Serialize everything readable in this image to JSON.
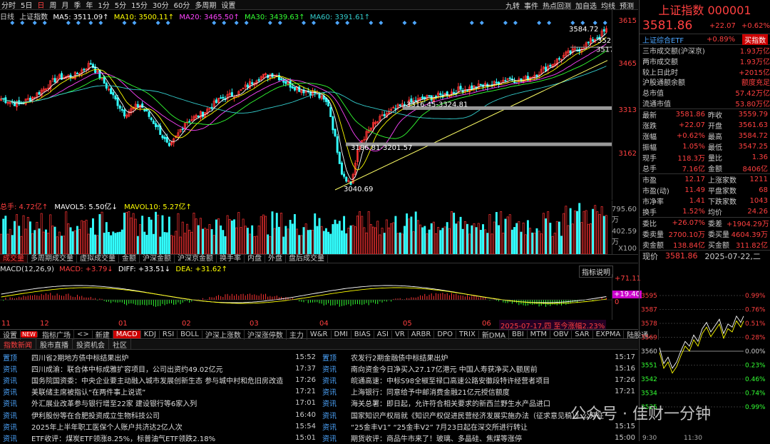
{
  "toolbar": {
    "items": [
      "分时",
      "5日",
      "日",
      "周",
      "月",
      "季",
      "年",
      "1分",
      "5分",
      "15分",
      "30分",
      "60分",
      "多周期",
      "设置"
    ],
    "selected": "日",
    "right": [
      "九转",
      "事件",
      "热点回测",
      "加自选",
      "均线",
      "预测"
    ]
  },
  "ma": {
    "period": "日线",
    "name": "上证指数",
    "ma5": "MA5: 3511.09↑",
    "ma10": "MA10: 3500.11↑",
    "ma20": "MA20: 3465.50↑",
    "ma30": "MA30: 3439.63↑",
    "ma60": "MA60: 3391.61↑"
  },
  "price_axis": {
    "labels": [
      "3615",
      "3465",
      "3313",
      "3162"
    ]
  },
  "annotations": {
    "high": "3584.72",
    "p1": "3316.45-3324.81",
    "p2": "3186.81-3201.57",
    "low": "3040.69",
    "r1": "352",
    "r2": "3517"
  },
  "volume": {
    "head_total": "总手: 4.72亿↑",
    "mavol5": "MAVOL5: 5.50亿↓",
    "mavol10": "MAVOL10: 5.27亿↑",
    "axis": [
      "795.60万",
      "402.59万",
      "X100"
    ]
  },
  "vtabs": [
    "成交量",
    "多周期成交量",
    "虚拟成交量",
    "金额",
    "沪深金额",
    "沪深京金额",
    "换手率",
    "内盘",
    "外盘",
    "盘后成交量"
  ],
  "macd": {
    "head": "MACD(12,26,9)",
    "macd": "MACD: +3.79↓",
    "diff": "DIFF: +33.51↓",
    "dea": "DEA: +31.62↑",
    "legend": "指标说明",
    "axis_top": "+71.11",
    "axis_mid": "+19.40",
    "axis_zero": "0"
  },
  "dates": [
    "11",
    "12",
    "01",
    "02",
    "03",
    "04",
    "05",
    "06"
  ],
  "date_highlight": "2025-07-17,四 至今涨幅2.23%",
  "bottom_tabs": [
    "设置",
    "NEW",
    "指标广场",
    "<>",
    "新建",
    "MACD",
    "KDJ",
    "RSI",
    "BOLL",
    "沪深上涨数",
    "沪深涨停数",
    "主力",
    "W&R",
    "DMI",
    "BIAS",
    "ASI",
    "VR",
    "ARBR",
    "DPO",
    "TRIX",
    "新DMA",
    "BBI",
    "MTM",
    "OBV",
    "SAR",
    "EXPMA",
    "陆股通..."
  ],
  "news_tabs": [
    "指数新闻",
    "股市直播",
    "投资机会",
    "社区"
  ],
  "news_left": [
    {
      "tag": "置顶",
      "title": "四川省2期地方债中标结果出炉",
      "time": "15:52"
    },
    {
      "tag": "资讯",
      "title": "四川成渝：联合体中标成雅扩容项目，公司出资约49.02亿元",
      "time": "17:37"
    },
    {
      "tag": "资讯",
      "title": "国务院国资委：中央企业要主动融入城市发展创新生态 参与城中村和危旧房改造",
      "time": "17:26"
    },
    {
      "tag": "资讯",
      "title": "美联储主席被指认“在两件事上说谎”",
      "time": "17:21"
    },
    {
      "tag": "资讯",
      "title": "外汇展业改革参与银行增至22家 建设银行等6家入列",
      "time": "17:01"
    },
    {
      "tag": "资讯",
      "title": "伊利股份等在合肥投资成立生物科技公司",
      "time": "16:40"
    },
    {
      "tag": "资讯",
      "title": "2025年上半年职工医保个人账户共济达2亿人次",
      "time": "15:54"
    },
    {
      "tag": "资讯",
      "title": "ETF收评：煤炭ETF领涨8.25%，标普油气ETF领跌2.18%",
      "time": "15:01"
    }
  ],
  "news_right": [
    {
      "tag": "置顶",
      "title": "农发行2期金融债中标结果出炉",
      "time": "15:17"
    },
    {
      "tag": "资讯",
      "title": "南向资金今日净买入27.17亿港元 中国人寿获净买入额居前",
      "time": "15:16"
    },
    {
      "tag": "资讯",
      "title": "皖通高速：中标S98全椒至禄口高速公路安徽段特许经营者项目",
      "time": "17:26"
    },
    {
      "tag": "资讯",
      "title": "上海银行：同意给予中邮消费金融21亿元授信额度",
      "time": "17:21"
    },
    {
      "tag": "资讯",
      "title": "海关总署：即日起，允许符合相关要求的新西兰野生水产品进口",
      "time": ""
    },
    {
      "tag": "资讯",
      "title": "国家知识产权局就《知识产权促进民营经济发展实施办法（征求意见稿）》公开征",
      "time": ""
    },
    {
      "tag": "资讯",
      "title": "“25金丰V1” “25金丰V2” 7月23日起在深交所进行转让",
      "time": "15:15"
    },
    {
      "tag": "资讯",
      "title": "期货收评：商品牛市来了！玻璃、多晶硅、焦煤等涨停",
      "time": "15:00"
    }
  ],
  "quote": {
    "title": "上证指数 000001",
    "price": "3581.86",
    "chg": "+22.07",
    "pct": "+0.62%",
    "etf_name": "上证综合ETF",
    "etf_pct": "+0.89%",
    "etf_btn": "买指数",
    "kv": [
      {
        "k": "三市成交额(沪深京)",
        "v": "1.93万亿"
      },
      {
        "k": "两市成交额",
        "v": "1.93万亿"
      },
      {
        "k": "较上日此时",
        "v": "+2015亿"
      },
      {
        "k": "沪股通额余额",
        "v": "额度充足"
      },
      {
        "k": "总市值",
        "v": "57.42万亿"
      },
      {
        "k": "流通市值",
        "v": "53.80万亿"
      }
    ],
    "grid": [
      [
        "最新",
        "3581.86",
        "昨收",
        "3559.79"
      ],
      [
        "涨跌",
        "+22.07",
        "开盘",
        "3561.63"
      ],
      [
        "涨幅",
        "+0.62%",
        "最高",
        "3584.72"
      ],
      [
        "振幅",
        "1.05%",
        "最低",
        "3547.25"
      ],
      [
        "现手",
        "118.3万",
        "量比",
        "1.36"
      ],
      [
        "总手",
        "7.16亿",
        "金额",
        "8406亿"
      ]
    ],
    "grid2": [
      [
        "市盈",
        "12.17",
        "上涨家数",
        "1211"
      ],
      [
        "市盈(动)",
        "11.49",
        "平盘家数",
        "68"
      ],
      [
        "市净率",
        "1.41",
        "下跌家数",
        "1043"
      ],
      [
        "换手",
        "1.52%",
        "均价",
        "24.26"
      ]
    ],
    "grid3": [
      [
        "委比",
        "+26.07%",
        "委差",
        "+1904.29万"
      ],
      [
        "委卖量",
        "2700.10万",
        "委买量",
        "4604.39万"
      ],
      [
        "卖金额",
        "138.84亿",
        "买金额",
        "311.82亿"
      ]
    ],
    "mini_label": "现价",
    "mini_price": "3581.86",
    "mini_date": "2025-07-22,二",
    "mini_left": [
      "3595",
      "3587",
      "3578",
      "3569",
      "3560",
      "3551",
      "3542",
      "3534",
      "3525"
    ],
    "mini_right": [
      "0.99%",
      "0.76%",
      "0.51%",
      "0.28%",
      "0.00%",
      "0.23%",
      "0.46%",
      "0.74%",
      "0.99%"
    ],
    "mini_x": [
      "9:30",
      "11:30"
    ]
  },
  "watermark": "公众号 · 佳财一分钟"
}
